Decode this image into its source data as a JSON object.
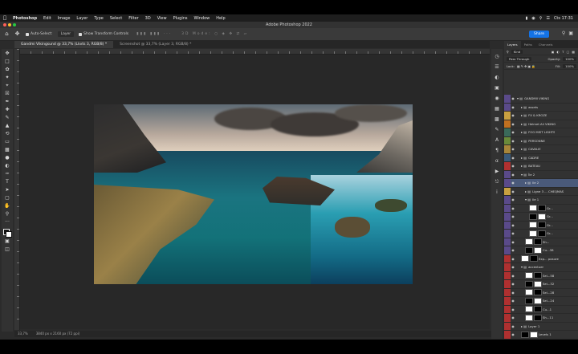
{
  "menubar": {
    "items": [
      "Photoshop",
      "Edit",
      "Image",
      "Layer",
      "Type",
      "Select",
      "Filter",
      "3D",
      "View",
      "Plugins",
      "Window",
      "Help"
    ],
    "clock": "Cts 17:31"
  },
  "titlebar": {
    "title": "Adobe Photoshop 2022"
  },
  "options": {
    "auto_select": "Auto-Select:",
    "layer_dd": "Layer",
    "show_transform": "Show Transform Controls",
    "share": "Share"
  },
  "tabs": [
    {
      "label": "Gandmi Vikingsund @ 33,7% (Lkvts 3, RGB/8) *"
    },
    {
      "label": "Screenshot @ 33,7% (Layer 3, RGB/8) *"
    }
  ],
  "status": {
    "zoom": "33,7%",
    "doc": "3840 px x 2160 px (72 ppi)"
  },
  "panel": {
    "tabs": [
      "Layers",
      "Paths",
      "Channels"
    ],
    "kind": "Kind",
    "blend": "Pass Through",
    "opacity_label": "Opacity:",
    "opacity": "100%",
    "lock_label": "Lock:",
    "fill_label": "Fill:",
    "fill": "100%"
  },
  "layers": [
    {
      "name": "GANDMII VIKING",
      "color": "#5a4a8a",
      "indent": 0,
      "type": "folder",
      "open": true
    },
    {
      "name": "assets",
      "color": "#5a4a8a",
      "indent": 1,
      "type": "folder",
      "open": false
    },
    {
      "name": "FX & KROZE",
      "color": "#c8a040",
      "indent": 1,
      "type": "folder",
      "open": false
    },
    {
      "name": "Helmet Ali VIKING",
      "color": "#c07020",
      "indent": 1,
      "type": "folder",
      "open": false
    },
    {
      "name": "FOG MIST LIGHTS",
      "color": "#3a6a5a",
      "indent": 1,
      "type": "folder",
      "open": false
    },
    {
      "name": "PERSONNE",
      "color": "#6a8a3a",
      "indent": 1,
      "type": "folder",
      "open": false
    },
    {
      "name": "CAVALIE",
      "color": "#a8863a",
      "indent": 1,
      "type": "folder",
      "open": false
    },
    {
      "name": "CADRE",
      "color": "#3a5a7a",
      "indent": 1,
      "type": "folder",
      "open": false
    },
    {
      "name": "BATEAU",
      "color": "#b03030",
      "indent": 1,
      "type": "folder",
      "open": false
    },
    {
      "name": "Île 2",
      "color": "#5a4a8a",
      "indent": 1,
      "type": "folder",
      "open": true
    },
    {
      "name": "Ile 2",
      "color": "#5a4a8a",
      "indent": 2,
      "type": "folder",
      "open": false,
      "selected": true
    },
    {
      "name": "Ligne 3 ... CHEQMAS",
      "color": "#c8a040",
      "indent": 2,
      "type": "folder",
      "open": false
    },
    {
      "name": "Ile 1",
      "color": "#5a4a8a",
      "indent": 2,
      "type": "folder",
      "open": true
    },
    {
      "name": "Gr...",
      "color": "#5a4a8a",
      "indent": 3,
      "type": "layer",
      "thumb": "light"
    },
    {
      "name": "Gr...",
      "color": "#5a4a8a",
      "indent": 3,
      "type": "layer",
      "thumb": "dark"
    },
    {
      "name": "Gr...",
      "color": "#5a4a8a",
      "indent": 3,
      "type": "layer",
      "thumb": "light"
    },
    {
      "name": "Gr...",
      "color": "#5a4a8a",
      "indent": 3,
      "type": "layer",
      "thumb": "light"
    },
    {
      "name": "Sh...",
      "color": "#5a4a8a",
      "indent": 2,
      "type": "layer",
      "thumb": "light"
    },
    {
      "name": "Cu...38",
      "color": "#5a4a8a",
      "indent": 2,
      "type": "layer",
      "thumb": "dark"
    },
    {
      "name": "Exp... posure",
      "color": "#b03030",
      "indent": 1,
      "type": "layer",
      "thumb": "light"
    },
    {
      "name": "accentuer",
      "color": "#b03030",
      "indent": 1,
      "type": "folder",
      "open": true
    },
    {
      "name": "Sel...58",
      "color": "#b03030",
      "indent": 2,
      "type": "layer",
      "thumb": "light"
    },
    {
      "name": "Sel...32",
      "color": "#b03030",
      "indent": 2,
      "type": "layer",
      "thumb": "dark"
    },
    {
      "name": "Sel...28",
      "color": "#b03030",
      "indent": 2,
      "type": "layer",
      "thumb": "light"
    },
    {
      "name": "Sel...24",
      "color": "#b03030",
      "indent": 2,
      "type": "layer",
      "thumb": "dark"
    },
    {
      "name": "Cu...1",
      "color": "#b03030",
      "indent": 2,
      "type": "layer",
      "thumb": "light"
    },
    {
      "name": "Sh...11",
      "color": "#b03030",
      "indent": 2,
      "type": "layer",
      "thumb": "light"
    },
    {
      "name": "Layer 1",
      "color": "#b03030",
      "indent": 1,
      "type": "folder",
      "open": false
    },
    {
      "name": "Levels 1",
      "color": "#b03030",
      "indent": 1,
      "type": "layer",
      "thumb": "dark"
    },
    {
      "name": "Umb... g 6",
      "color": "#b03030",
      "indent": 1,
      "type": "layer",
      "thumb": "light"
    },
    {
      "name": "Ye...",
      "color": "#b03030",
      "indent": 1,
      "type": "layer",
      "thumb": "light"
    }
  ]
}
